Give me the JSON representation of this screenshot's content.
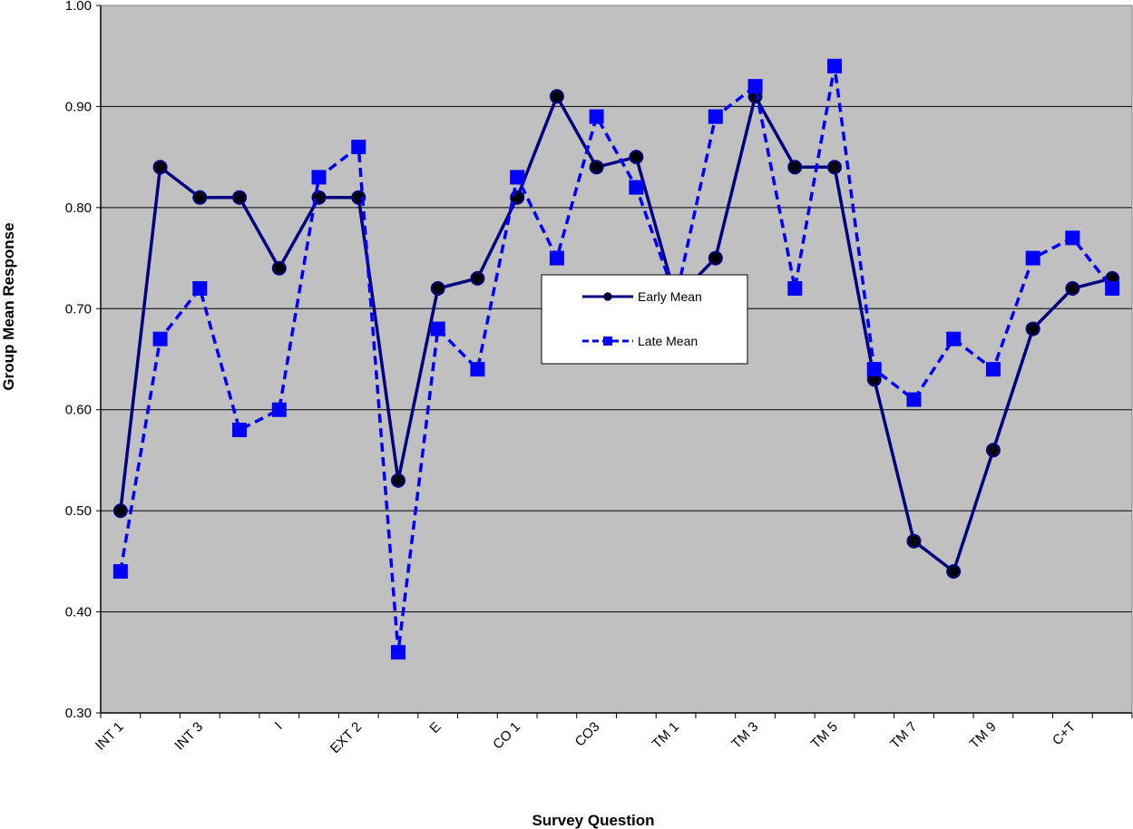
{
  "chart_data": {
    "type": "line",
    "title": "",
    "xlabel": "Survey Question",
    "ylabel": "Group Mean Response",
    "ylim": [
      0.3,
      1.0
    ],
    "yticks": [
      "0.30",
      "0.40",
      "0.50",
      "0.60",
      "0.70",
      "0.80",
      "0.90",
      "1.00"
    ],
    "grid": true,
    "legend_position": "center",
    "categories": [
      "INT 1",
      "",
      "INT 3",
      "",
      "I",
      "",
      "EXT 2",
      "",
      "E",
      "",
      "CO 1",
      "",
      "CO3",
      "",
      "TM 1",
      "",
      "TM 3",
      "",
      "TM 5",
      "",
      "TM 7",
      "",
      "TM 9",
      "",
      "C+T",
      ""
    ],
    "series": [
      {
        "name": "Early Mean",
        "color": "#000080",
        "line_style": "solid",
        "marker": "circle",
        "values": [
          0.5,
          0.84,
          0.81,
          0.81,
          0.74,
          0.81,
          0.81,
          0.53,
          0.72,
          0.73,
          0.81,
          0.91,
          0.84,
          0.85,
          0.71,
          0.75,
          0.91,
          0.84,
          0.84,
          0.63,
          0.47,
          0.44,
          0.56,
          0.68,
          0.72,
          0.73
        ]
      },
      {
        "name": "Late Mean",
        "color": "#0000FF",
        "line_style": "dashed",
        "marker": "square",
        "values": [
          0.44,
          0.67,
          0.72,
          0.58,
          0.6,
          0.83,
          0.86,
          0.36,
          0.68,
          0.64,
          0.83,
          0.75,
          0.89,
          0.82,
          0.71,
          0.89,
          0.92,
          0.72,
          0.94,
          0.64,
          0.61,
          0.67,
          0.64,
          0.75,
          0.77,
          0.72
        ]
      }
    ],
    "plot_background": "#C0C0C0"
  }
}
